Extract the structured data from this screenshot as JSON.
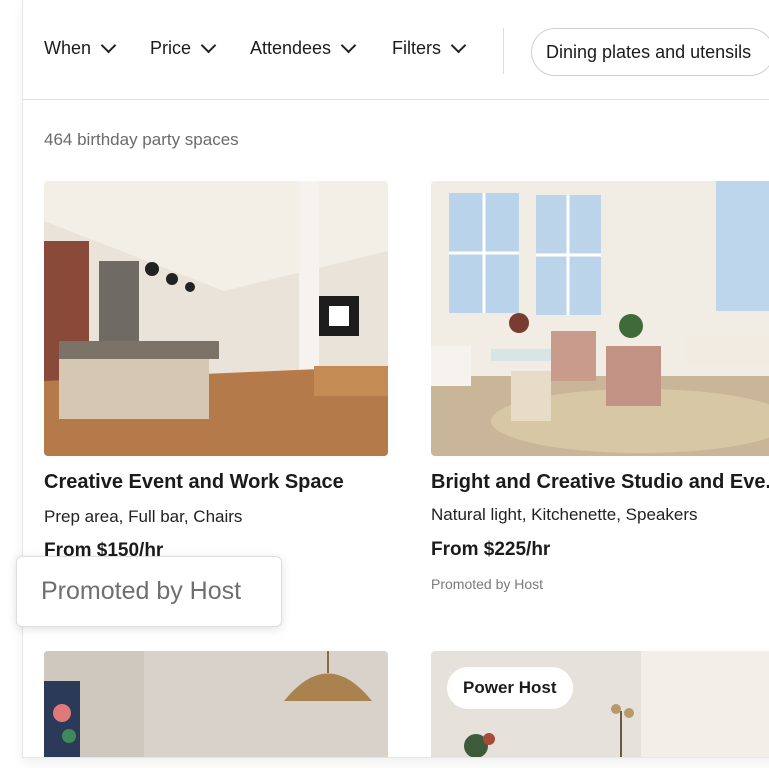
{
  "filters": {
    "when": "When",
    "price": "Price",
    "attendees": "Attendees",
    "filters": "Filters",
    "pill": "Dining plates and utensils"
  },
  "results_count": "464 birthday party spaces",
  "listings": [
    {
      "title": "Creative Event and Work Space",
      "amenities": "Prep area, Full bar, Chairs",
      "price": "From $150/hr"
    },
    {
      "title": "Bright and Creative Studio and Eve...",
      "amenities": "Natural light, Kitchenette, Speakers",
      "price": "From $225/hr",
      "promoted": "Promoted by Host"
    },
    {
      "badge": "Power Host"
    }
  ],
  "tooltip": "Promoted by Host",
  "colors": {
    "text": "#1b1b1b",
    "muted": "#6b6b6b",
    "border": "#dcdcdc"
  }
}
